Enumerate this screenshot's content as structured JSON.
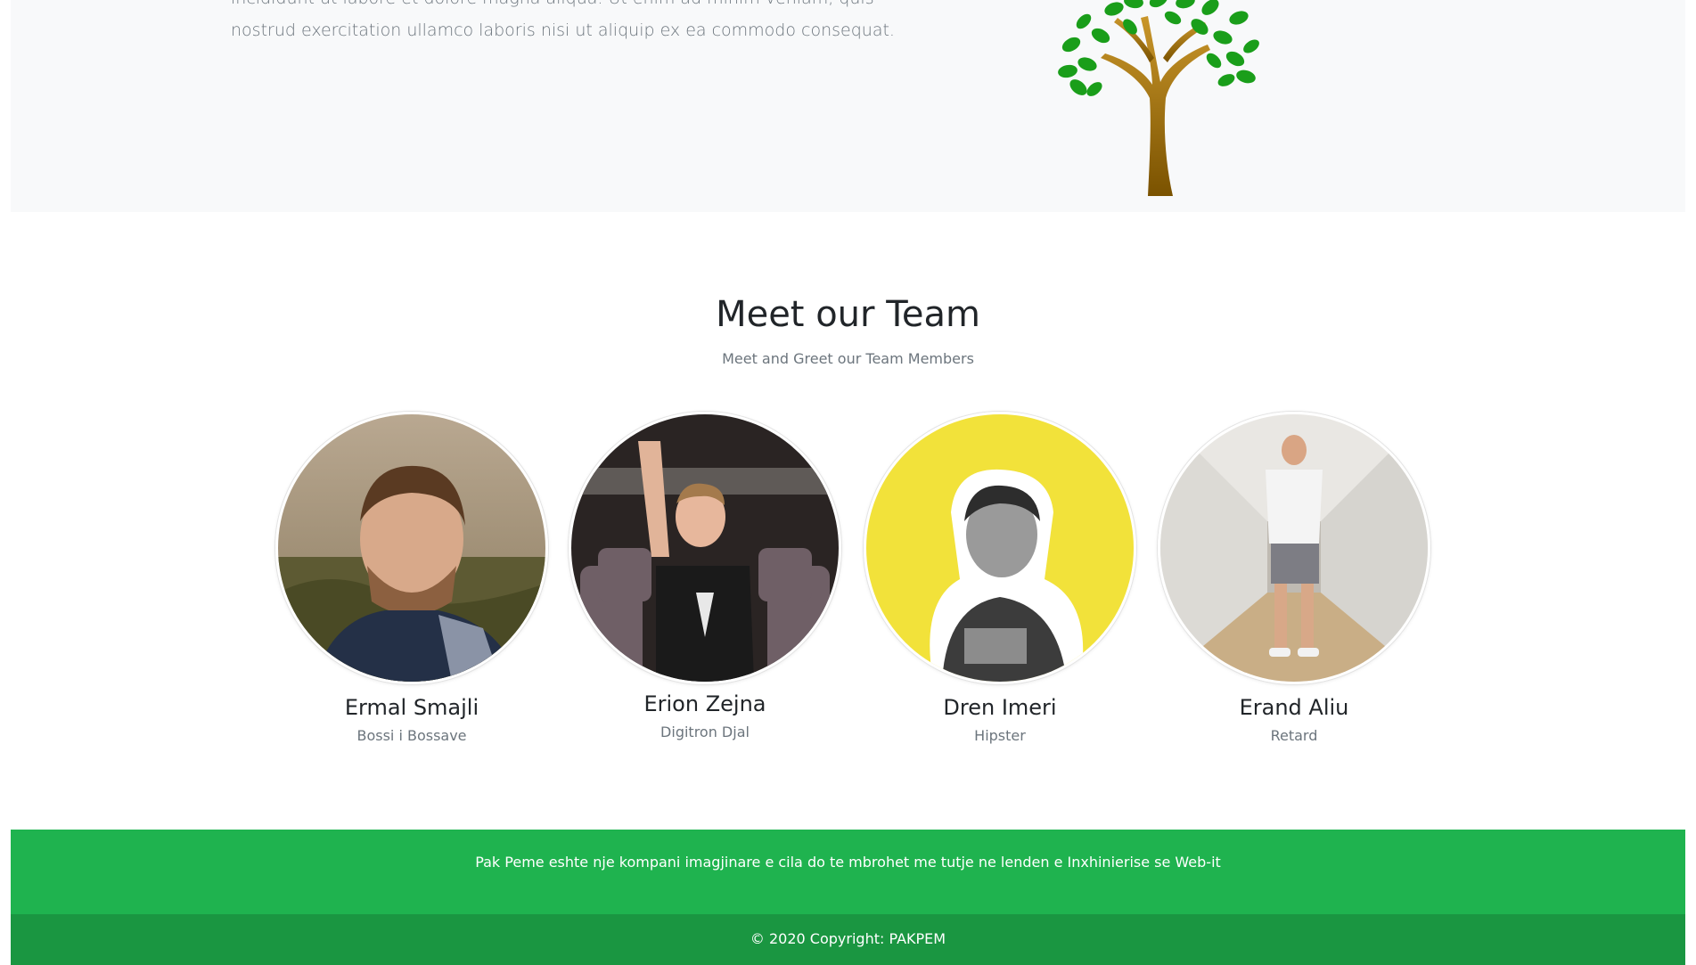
{
  "about": {
    "lines": [
      "incididunt ut labore et dolore magna aliqua. Ut enim ad minim veniam, quis",
      "nostrud exercitation ullamco laboris nisi ut aliquip ex ea commodo consequat."
    ]
  },
  "team": {
    "title": "Meet our Team",
    "subtitle": "Meet and Greet our Team Members",
    "members": [
      {
        "name": "Ermal Smajli",
        "role": "Bossi i Bossave"
      },
      {
        "name": "Erion Zejna",
        "role": "Digitron Djal"
      },
      {
        "name": "Dren Imeri",
        "role": "Hipster"
      },
      {
        "name": "Erand Aliu",
        "role": "Retard"
      }
    ]
  },
  "footer": {
    "text": "Pak Peme eshte nje kompani imagjinare e cila do te mbrohet me tutje ne lenden e Inxhinierise se Web-it",
    "copyright": "© 2020 Copyright: PAKPEM"
  },
  "colors": {
    "footer_green": "#1fb34f",
    "footer_dark_green": "#1a9641",
    "about_bg": "#f8f9fa",
    "leaf_green": "#1a9e1a",
    "trunk_brown": "#9a6a06"
  }
}
